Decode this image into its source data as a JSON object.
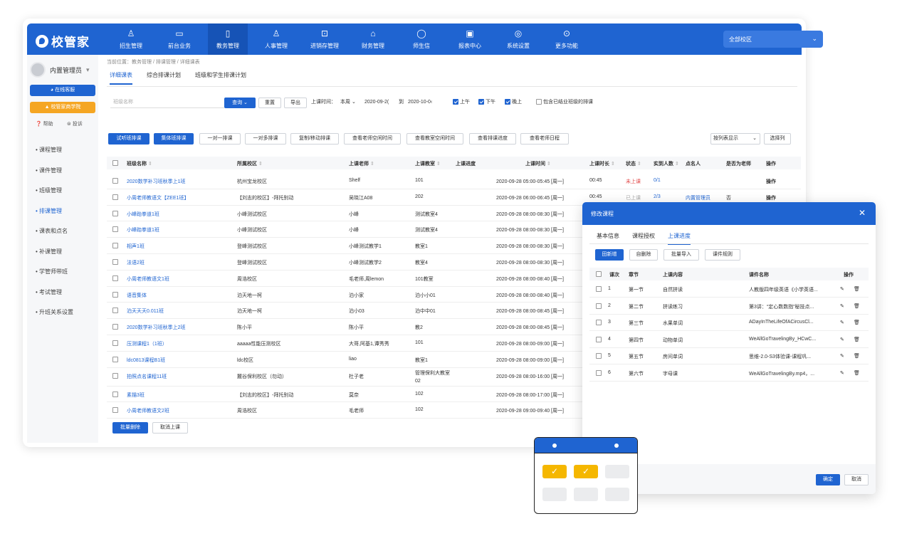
{
  "brand": "校管家",
  "nav": [
    {
      "label": "招生管理",
      "icon": "person-add-icon",
      "glyph": "♙"
    },
    {
      "label": "前台业务",
      "icon": "monitor-icon",
      "glyph": "▭"
    },
    {
      "label": "教务管理",
      "icon": "book-icon",
      "glyph": "▯"
    },
    {
      "label": "人事管理",
      "icon": "user-icon",
      "glyph": "♙"
    },
    {
      "label": "进销存管理",
      "icon": "inventory-icon",
      "glyph": "⊡"
    },
    {
      "label": "财务管理",
      "icon": "wallet-icon",
      "glyph": "⌂"
    },
    {
      "label": "师生信",
      "icon": "chat-icon",
      "glyph": "◯"
    },
    {
      "label": "报表中心",
      "icon": "report-icon",
      "glyph": "▣"
    },
    {
      "label": "系统设置",
      "icon": "settings-icon",
      "glyph": "◎"
    },
    {
      "label": "更多功能",
      "icon": "more-icon",
      "glyph": "⊙"
    }
  ],
  "campus": "全部校区",
  "sidebar": {
    "user": "内置管理员",
    "service": "在线客服",
    "academy": "校管家商学院",
    "help": "帮助",
    "complain": "投诉",
    "items": [
      "课程管理",
      "课件管理",
      "班级管理",
      "排课管理",
      "课表和点名",
      "补课管理",
      "学管师带班",
      "考试管理",
      "升班关系设置"
    ]
  },
  "breadcrumb": "当前位置：教务管理 / 排课管理 / 详细课表",
  "tabs": [
    "详细课表",
    "综合排课计划",
    "班级和学生排课计划"
  ],
  "filter": {
    "placeholder": "班级名称",
    "query": "查询",
    "reset": "重置",
    "export": "导出",
    "time_label": "上课时间：",
    "period": "本周",
    "date_from": "2020-09-2(",
    "to": "到",
    "date_to": "2020-10-0‹",
    "am": "上午",
    "pm": "下午",
    "eve": "晚上",
    "include_ended": "包含已结业班级的排课"
  },
  "toolbar": [
    "试听班排课",
    "集体班排课",
    "一对一排课",
    "一对多排课",
    "复制/移动排课",
    "查看老师空闲时间",
    "查看教室空闲时间",
    "查看排课进度",
    "查看老师日程"
  ],
  "view_mode": "按列表显示",
  "select_cols": "选择列",
  "columns": [
    "班级名称",
    "所属校区",
    "上课老师",
    "上课教室",
    "上课进度",
    "上课时间",
    "上课时长",
    "状态",
    "实到人数",
    "点名人",
    "是否为老师",
    "操作"
  ],
  "rows": [
    {
      "name": "2020数学补习班秋季上1班",
      "campus": "杭州宝龙校区",
      "teacher": "Shelf",
      "room": "101",
      "time": "2020-09-28 05:00-05:45 [周一]",
      "dur": "00:45",
      "status": "未上课",
      "att": "0/1",
      "caller": "",
      "isT": "",
      "op": "操作"
    },
    {
      "name": "小周老师教语文【ZEE1班】",
      "campus": "【刘志的校区】-拜托别动",
      "teacher": "吴晓江A08",
      "room": "202",
      "time": "2020-09-28 06:00-06:45 [周一]",
      "dur": "00:45",
      "status": "已上课",
      "att": "2/3",
      "caller": "内置管理员",
      "isT": "否",
      "op": "操作"
    },
    {
      "name": "小峰跆拳道1班",
      "campus": "小峰测试校区",
      "teacher": "小峰",
      "room": "测试教室4",
      "time": "2020-09-28 08:00-08:30 [周一]"
    },
    {
      "name": "小峰跆拳道1班",
      "campus": "小峰测试校区",
      "teacher": "小峰",
      "room": "测试教室4",
      "time": "2020-09-28 08:00-08:30 [周一]"
    },
    {
      "name": "相声1班",
      "campus": "登峰测试校区",
      "teacher": "小峰测试教学1",
      "room": "教室1",
      "time": "2020-09-28 08:00-08:30 [周一]"
    },
    {
      "name": "法语2班",
      "campus": "登峰测试校区",
      "teacher": "小峰测试教学2",
      "room": "教室4",
      "time": "2020-09-28 08:00-08:30 [周一]"
    },
    {
      "name": "小周老师教语文1班",
      "campus": "周浩校区",
      "teacher": "毛老师,周lemon",
      "room": "101教室",
      "time": "2020-09-28 08:00-08:40 [周一]"
    },
    {
      "name": "语音集体",
      "campus": "泊天地一柯",
      "teacher": "泊小家",
      "room": "泊小小01",
      "time": "2020-09-28 08:00-08:40 [周一]"
    },
    {
      "name": "泊天天天0.011班",
      "campus": "泊天地一柯",
      "teacher": "泊小03",
      "room": "泊中中01",
      "time": "2020-09-28 08:00-08:45 [周一]"
    },
    {
      "name": "2020数学补习班秋季上2班",
      "campus": "陈小平",
      "teacher": "陈小平",
      "room": "教2",
      "time": "2020-09-28 08:00-08:45 [周一]"
    },
    {
      "name": "压测课程1（1班）",
      "campus": "aaaaa性能压测校区",
      "teacher": "大哥,阿基1,谭秀秀",
      "room": "101",
      "time": "2020-09-28 08:00-09:00 [周一]"
    },
    {
      "name": "ldc0813课程B1班",
      "campus": "ldc校区",
      "teacher": "liao",
      "room": "教室1",
      "time": "2020-09-28 08:00-09:00 [周一]"
    },
    {
      "name": "拍照点名课程11班",
      "campus": "麓谷保利校区（勿动）",
      "teacher": "杜子老",
      "room": "管理保利大教室02",
      "time": "2020-09-28 08:00-16:00 [周一]"
    },
    {
      "name": "素描3班",
      "campus": "【刘志的校区】-拜托别动",
      "teacher": "莫奈",
      "room": "102",
      "time": "2020-09-28 08:00-17:00 [周一]"
    },
    {
      "name": "小周老师教语文2班",
      "campus": "周浩校区",
      "teacher": "毛老师",
      "room": "102",
      "time": "2020-09-28 09:00-09:40 [周一]"
    }
  ],
  "batch_delete": "批量删除",
  "cancel_class": "取消上课",
  "modal": {
    "title": "修改课程",
    "tabs": [
      "基本信息",
      "课程授权",
      "上课进度"
    ],
    "buttons": [
      "田新增",
      "自删除",
      "批量导入",
      "课件规则"
    ],
    "columns": [
      "课次",
      "章节",
      "上课内容",
      "课件名称",
      "操作"
    ],
    "rows": [
      {
        "n": "1",
        "ch": "第一节",
        "content": "自然拼读",
        "file": "人教版四年级英语《小学英语..."
      },
      {
        "n": "2",
        "ch": "第二节",
        "content": "拼读练习",
        "file": "第3讲：“定心数数指”秘技点..."
      },
      {
        "n": "3",
        "ch": "第三节",
        "content": "水果单词",
        "file": "ADayInTheLifeOfACircusCl..."
      },
      {
        "n": "4",
        "ch": "第四节",
        "content": "动物单词",
        "file": "WeAllGoTravelingBy_HCwC..."
      },
      {
        "n": "5",
        "ch": "第五节",
        "content": "房间单词",
        "file": "思维-2.0-S3体验课-课程巩..."
      },
      {
        "n": "6",
        "ch": "第六节",
        "content": "字母课",
        "file": "WeAllGoTravelingBy.mp4，..."
      }
    ],
    "ok": "确定",
    "cancel": "取消"
  },
  "calendar": {
    "checked": 2,
    "total": 6
  }
}
